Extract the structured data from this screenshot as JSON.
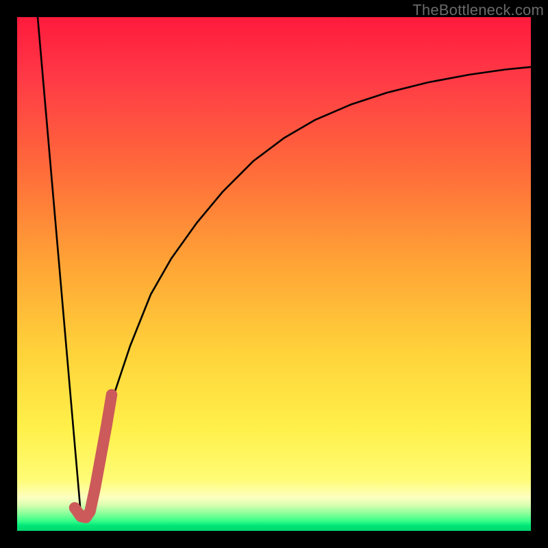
{
  "watermark": "TheBottleneck.com",
  "palette": {
    "curve_stroke": "#000000",
    "thick_stroke": "#cc5a5a",
    "frame": "#000000"
  },
  "chart_data": {
    "type": "line",
    "title": "",
    "xlabel": "",
    "ylabel": "",
    "xlim": [
      0,
      100
    ],
    "ylim": [
      0,
      100
    ],
    "series": [
      {
        "name": "left-falling-line",
        "x": [
          4,
          12.5
        ],
        "y": [
          100,
          2
        ]
      },
      {
        "name": "rising-saturating-curve",
        "x": [
          13,
          15,
          18,
          22,
          26,
          30,
          35,
          40,
          46,
          52,
          58,
          65,
          72,
          80,
          88,
          95,
          100
        ],
        "y": [
          2,
          12,
          24,
          36,
          46,
          53,
          60,
          66,
          72,
          76.5,
          80,
          83,
          85.3,
          87.3,
          88.8,
          89.8,
          90.3
        ]
      },
      {
        "name": "thick-red-hook",
        "x": [
          11.2,
          12.4,
          13.4,
          14.2,
          15.2,
          16.3,
          17.4,
          18.4
        ],
        "y": [
          4.5,
          2.8,
          2.6,
          3.8,
          8.5,
          14.5,
          20.5,
          26.5
        ]
      }
    ]
  }
}
